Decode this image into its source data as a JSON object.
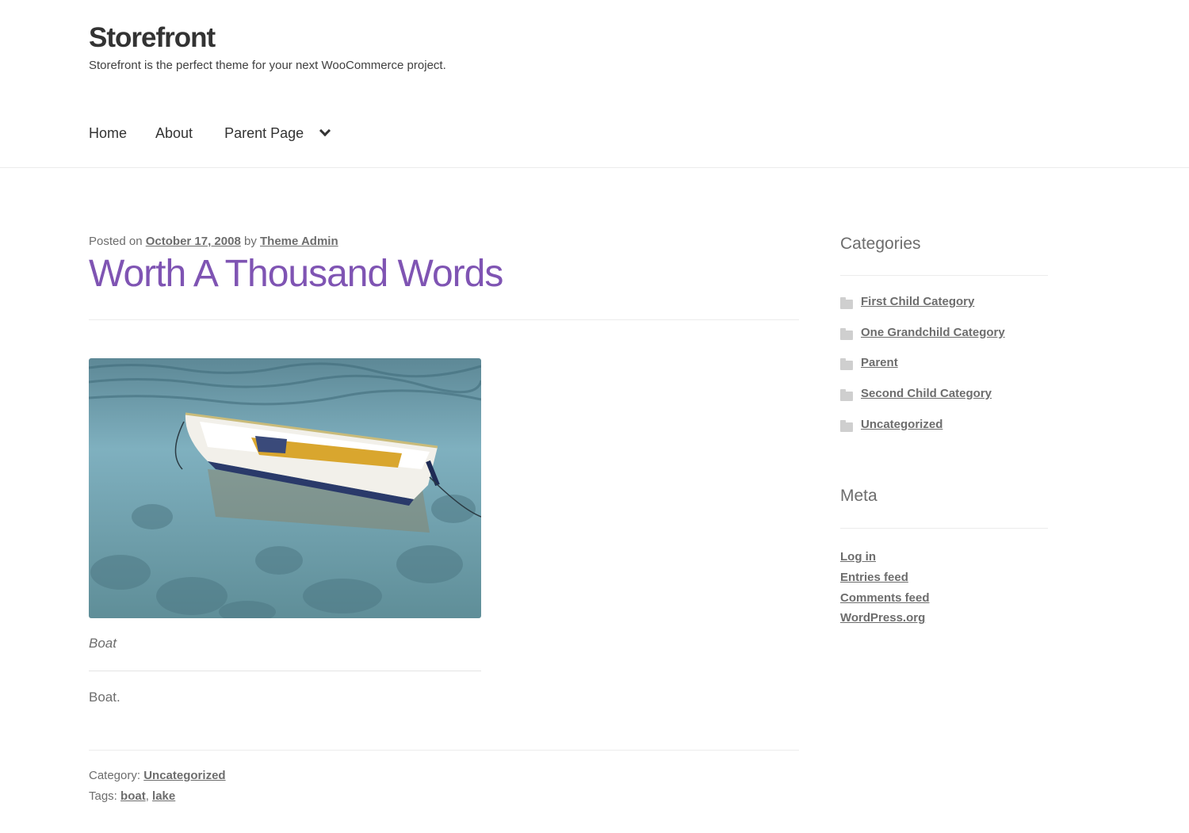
{
  "header": {
    "site_title": "Storefront",
    "tagline": "Storefront is the perfect theme for your next WooCommerce project."
  },
  "nav": {
    "items": [
      "Home",
      "About",
      "Parent Page"
    ],
    "dropdown_icon": "chevron-down-icon"
  },
  "post": {
    "posted_on_label": "Posted on",
    "date": "October 17, 2008",
    "by_label": "by",
    "author": "Theme Admin",
    "title": "Worth A Thousand Words",
    "image_caption": "Boat",
    "body": "Boat.",
    "category_label": "Category:",
    "category": "Uncategorized",
    "tags_label": "Tags:",
    "tags": [
      "boat",
      "lake"
    ],
    "tag_separator": ","
  },
  "sidebar": {
    "categories_title": "Categories",
    "categories": [
      "First Child Category",
      "One Grandchild Category",
      "Parent",
      "Second Child Category",
      "Uncategorized"
    ],
    "category_icon": "folder-icon",
    "meta_title": "Meta",
    "meta_links": [
      "Log in",
      "Entries feed",
      "Comments feed",
      "WordPress.org"
    ]
  },
  "colors": {
    "accent": "#7f54b3",
    "text": "#6d6d6d",
    "heading": "#333333"
  }
}
